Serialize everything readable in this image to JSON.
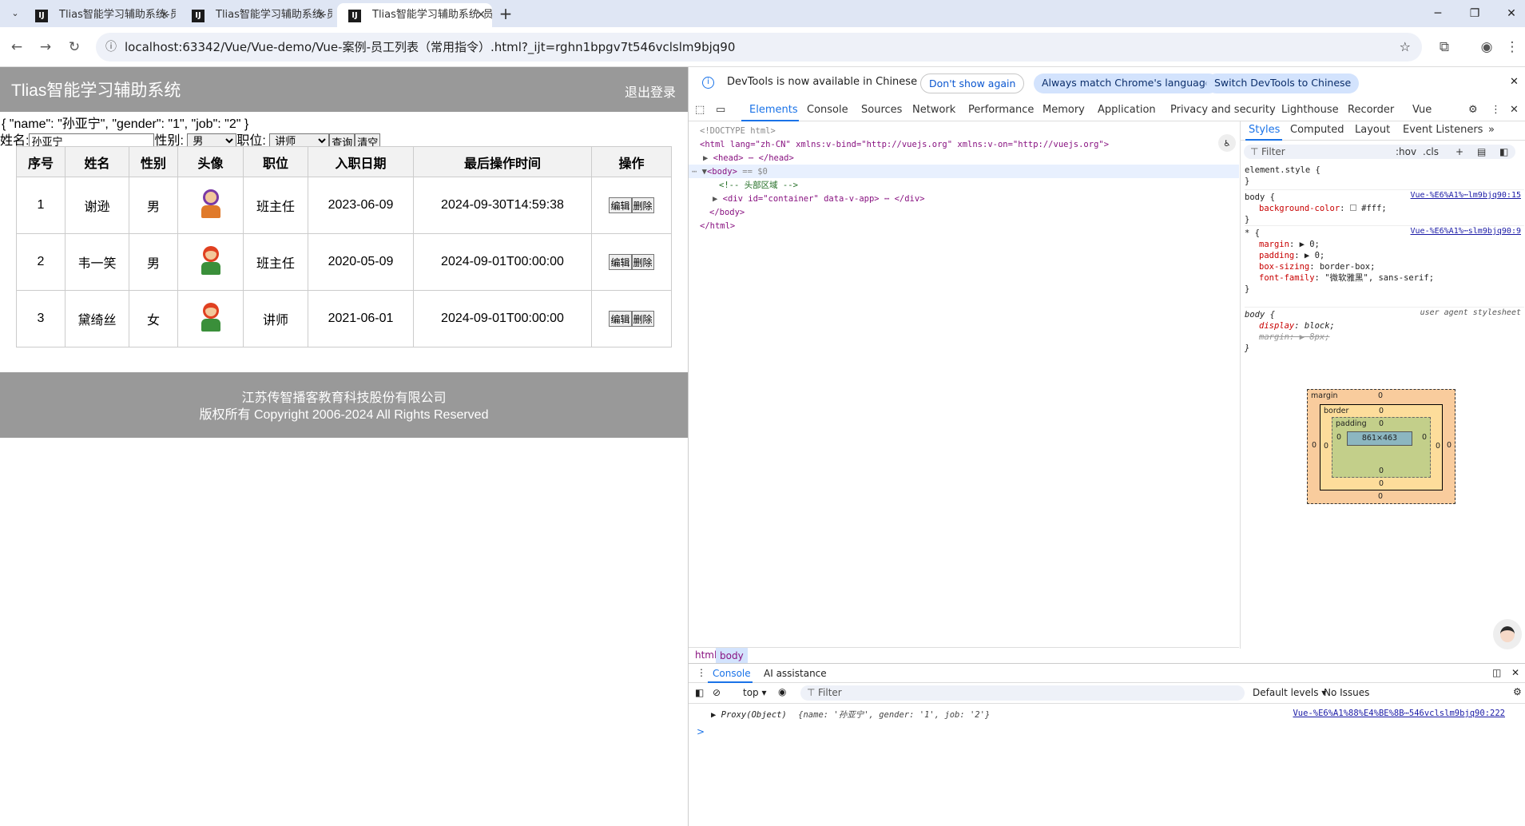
{
  "browser": {
    "tabs": [
      {
        "title": "Tlias智能学习辅助系统-员工列表",
        "active": false
      },
      {
        "title": "Tlias智能学习辅助系统-员工列表",
        "active": false
      },
      {
        "title": "Tlias智能学习辅助系统-员工列表",
        "active": true
      }
    ],
    "url": "localhost:63342/Vue/Vue-demo/Vue-案例-员工列表（常用指令）.html?_ijt=rghn1bpgv7t546vclslm9bjq90"
  },
  "page": {
    "header": {
      "title": "Tlias智能学习辅助系统",
      "logout": "退出登录"
    },
    "json_debug": "{ \"name\": \"孙亚宁\", \"gender\": \"1\", \"job\": \"2\" }",
    "search": {
      "name_label": "姓名:",
      "name_value": "孙亚宁",
      "gender_label": "性别:",
      "gender_value": "男",
      "job_label": "职位:",
      "job_value": "讲师",
      "query_button": "查询",
      "clear_button": "清空"
    },
    "table": {
      "headers": [
        "序号",
        "姓名",
        "性别",
        "头像",
        "职位",
        "入职日期",
        "最后操作时间",
        "操作"
      ],
      "rows": [
        {
          "id": "1",
          "name": "谢逊",
          "gender": "男",
          "job": "班主任",
          "entry": "2023-06-09",
          "update": "2024-09-30T14:59:38"
        },
        {
          "id": "2",
          "name": "韦一笑",
          "gender": "男",
          "job": "班主任",
          "entry": "2020-05-09",
          "update": "2024-09-01T00:00:00"
        },
        {
          "id": "3",
          "name": "黛绮丝",
          "gender": "女",
          "job": "讲师",
          "entry": "2021-06-01",
          "update": "2024-09-01T00:00:00"
        }
      ],
      "edit_label": "编辑",
      "delete_label": "删除"
    },
    "footer": {
      "line1": "江苏传智播客教育科技股份有限公司",
      "line2": "版权所有 Copyright 2006-2024 All Rights Reserved"
    }
  },
  "devtools": {
    "notice": {
      "message": "DevTools is now available in Chinese",
      "dont_show": "Don't show again",
      "always_match": "Always match Chrome's language",
      "switch": "Switch DevTools to Chinese"
    },
    "tabs": [
      "Elements",
      "Console",
      "Sources",
      "Network",
      "Performance",
      "Memory",
      "Application",
      "Privacy and security",
      "Lighthouse",
      "Recorder",
      "Vue"
    ],
    "dom": {
      "doctype": "<!DOCTYPE html>",
      "html_open": "<html lang=\"zh-CN\" xmlns:v-bind=\"http://vuejs.org\" xmlns:v-on=\"http://vuejs.org\">",
      "head": "<head> ⋯ </head>",
      "body_open": "<body>",
      "body_eq": "== $0",
      "comment": "<!-- 头部区域 -->",
      "div": "<div id=\"container\" data-v-app> ⋯ </div>",
      "body_close": "</body>",
      "html_close": "</html>"
    },
    "styles": {
      "tabs": [
        "Styles",
        "Computed",
        "Layout",
        "Event Listeners"
      ],
      "filter_placeholder": "Filter",
      "hov": ":hov",
      "cls": ".cls",
      "element_style": "element.style {",
      "rule1_sel": "body {",
      "rule1_src": "Vue-%E6%A1%⋯lm9bjq90:15",
      "rule1_prop": "background-color",
      "rule1_val": "#fff;",
      "rule2_sel": "* {",
      "rule2_src": "Vue-%E6%A1%⋯slm9bjq90:9",
      "rule2_props": [
        {
          "name": "margin",
          "value": "▶ 0;"
        },
        {
          "name": "padding",
          "value": "▶ 0;"
        },
        {
          "name": "box-sizing",
          "value": "border-box;"
        },
        {
          "name": "font-family",
          "value": "\"微软雅黑\", sans-serif;"
        }
      ],
      "rule3_sel": "body {",
      "rule3_src": "user agent stylesheet",
      "rule3_props": [
        {
          "name": "display",
          "value": "block;"
        },
        {
          "name": "margin",
          "value": "▶ 8px;"
        }
      ],
      "close_brace": "}"
    },
    "box_model": {
      "margin": "margin",
      "border": "border",
      "padding": "padding",
      "content": "861×463",
      "zero": "0"
    },
    "breadcrumb": [
      "html",
      "body"
    ],
    "console": {
      "tabs": [
        "Console",
        "AI assistance"
      ],
      "context": "top",
      "filter_placeholder": "Filter",
      "levels": "Default levels",
      "issues": "No Issues",
      "log_prefix": "▶ Proxy(Object)",
      "log_body": "{name: '孙亚宁', gender: '1', job: '2'}",
      "log_src": "Vue-%E6%A1%88%E4%BE%8B⋯546vclslm9bjq90:222",
      "prompt": ">"
    }
  }
}
